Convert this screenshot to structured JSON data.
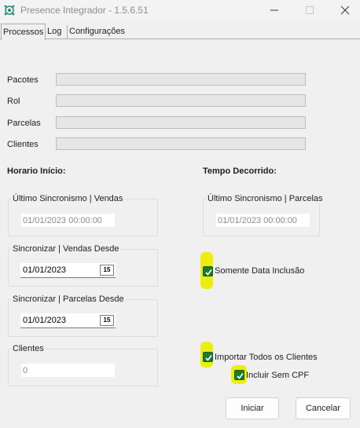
{
  "window": {
    "title": "Presence Integrador  -  1.5.6.51"
  },
  "tabs": [
    "Processos",
    "Log",
    "Configurações"
  ],
  "progress": [
    {
      "label": "Pacotes",
      "value": 0
    },
    {
      "label": "Rol",
      "value": 0
    },
    {
      "label": "Parcelas",
      "value": 0
    },
    {
      "label": "Clientes",
      "value": 0
    }
  ],
  "sections": {
    "horario_inicio": "Horario Início:",
    "tempo_decorrido": "Tempo Decorrido:"
  },
  "groups": {
    "ultimo_vendas": {
      "title": "Último Sincronismo  | Vendas",
      "value": "01/01/2023 00:00:00"
    },
    "ultimo_parcelas": {
      "title": "Último Sincronismo  | Parcelas",
      "value": "01/01/2023 00:00:00"
    },
    "sinc_vendas": {
      "title": "Sincronizar  | Vendas  Desde",
      "value": "01/01/2023"
    },
    "sinc_parcelas": {
      "title": "Sincronizar  | Parcelas Desde",
      "value": "01/01/2023"
    },
    "clientes": {
      "title": "Clientes",
      "value": "0"
    }
  },
  "calendar_icon_text": "15",
  "checkboxes": {
    "somente_data": {
      "label": "Somente Data Inclusão",
      "checked": true
    },
    "importar_todos": {
      "label": "Importar Todos os Clientes",
      "checked": true
    },
    "incluir_sem_cpf": {
      "label": "Incluir Sem CPF",
      "checked": true
    }
  },
  "buttons": {
    "iniciar": "Iniciar",
    "cancelar": "Cancelar"
  },
  "colors": {
    "highlight": "#eded10",
    "checkbox": "#1f7a2e",
    "window_bg": "#f0f0f0"
  }
}
